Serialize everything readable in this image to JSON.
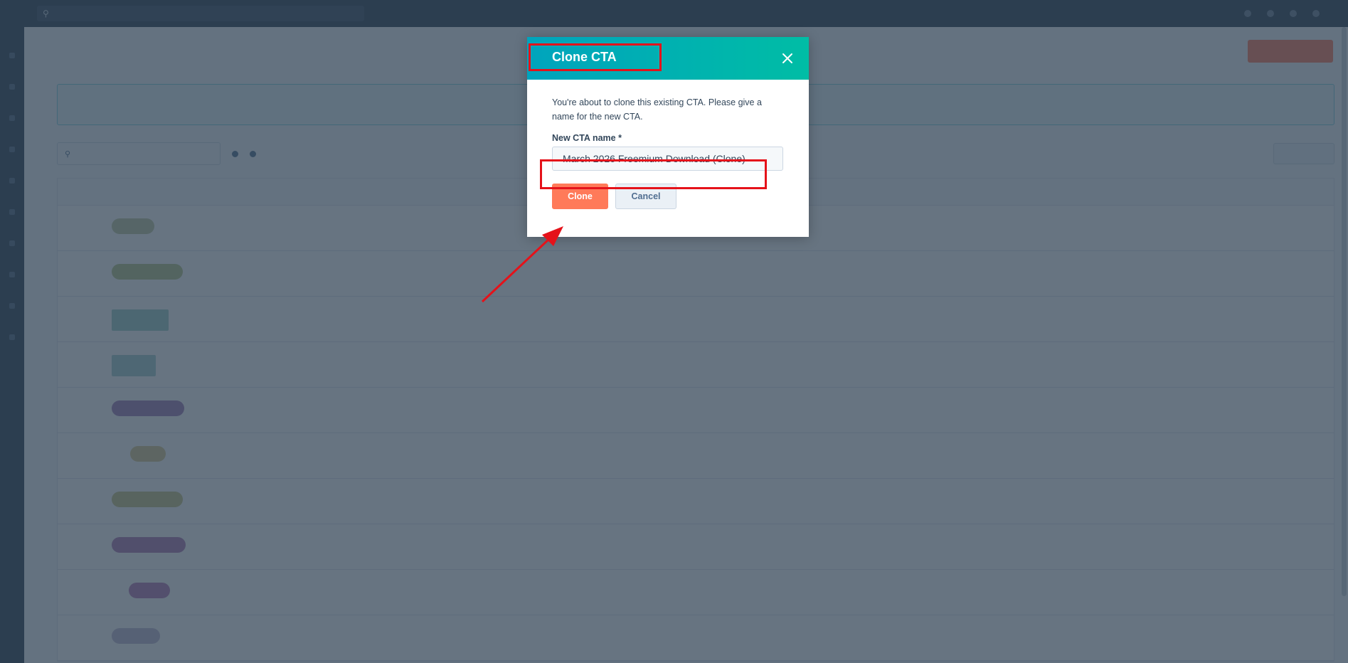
{
  "modal": {
    "title": "Clone CTA",
    "message": "You're about to clone this existing CTA. Please give a name for the new CTA.",
    "field_label": "New CTA name *",
    "field_value": "March 2026 Freemium Download (Clone)",
    "clone_label": "Clone",
    "cancel_label": "Cancel"
  },
  "annotations": {
    "highlight_color": "#e5121a"
  },
  "colors": {
    "header_start": "#00a4bd",
    "header_end": "#00bda5",
    "primary_button": "#ff7a59"
  }
}
